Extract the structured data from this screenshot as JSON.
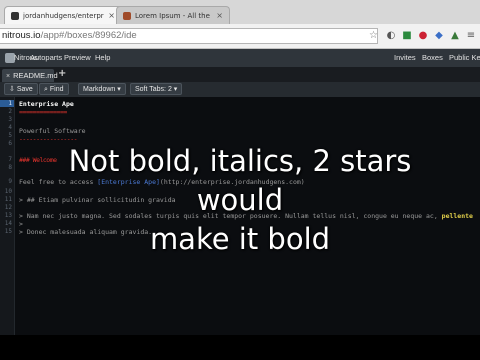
{
  "browser": {
    "tabs": [
      {
        "title": "jordanhudgens/enterpris",
        "active": true
      },
      {
        "title": "Lorem Ipsum - All the fac",
        "active": false
      }
    ],
    "address": {
      "host": "nitrous.io",
      "path": "/app#/boxes/89962/ide"
    }
  },
  "menubar": {
    "left_items": [
      "Nitrous",
      "Autoparts",
      "Preview",
      "Help"
    ],
    "right_items": [
      "Invites",
      "Boxes",
      "Public Key"
    ]
  },
  "file_tab": {
    "label": "README.md"
  },
  "toolbar": {
    "save_label": "Save",
    "find_label": "Find",
    "mode_label": "Markdown",
    "tabs_label": "Soft Tabs: 2"
  },
  "editor": {
    "active_line": 1,
    "lines": [
      {
        "n": "1",
        "text": "Enterprise Ape"
      },
      {
        "n": "2",
        "text": "=============="
      },
      {
        "n": "3",
        "text": ""
      },
      {
        "n": "4",
        "text": "Powerful Software"
      },
      {
        "n": "5",
        "text": "-----------------"
      },
      {
        "n": "6",
        "text": ""
      },
      {
        "n": "7",
        "text": "### Welcome"
      },
      {
        "n": "8",
        "text": ""
      },
      {
        "n": "9",
        "text": "Feel free to access",
        "link": "[Enterprise Ape]",
        "tail": "(http://enterprise.jordanhudgens.com)"
      },
      {
        "n": "10",
        "text": ""
      },
      {
        "n": "11",
        "text": "> ## Etiam pulvinar sollicitudin gravida"
      },
      {
        "n": "12",
        "text": ""
      },
      {
        "n": "13",
        "text": "> Nam nec justo magna. Sed sodales turpis quis elit tempor posuere. Nullam tellus nisl, congue eu neque ac,",
        "bold": "pellente"
      },
      {
        "n": "14",
        "text": ">"
      },
      {
        "n": "15",
        "text": "> Donec malesuada aliquam gravida."
      }
    ]
  },
  "caption": {
    "line1": "Not bold, italics, 2 stars",
    "line2": "would",
    "line3": "make it bold"
  },
  "colors": {
    "accent": "#2b5c96",
    "heading_underline": "#e2332c",
    "bold_text": "#e4d14b"
  }
}
